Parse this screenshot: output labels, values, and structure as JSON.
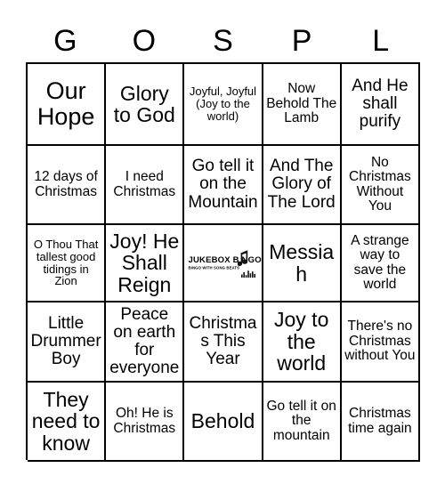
{
  "card": {
    "header_letters": [
      "G",
      "O",
      "S",
      "P",
      "L"
    ],
    "grid": {
      "rows": 5,
      "columns": 5,
      "cells": [
        [
          {
            "text": "Our Hope",
            "size": "xl"
          },
          {
            "text": "Glory to God",
            "size": "lg"
          },
          {
            "text": "Joyful, Joyful (Joy to the world)",
            "size": "xs"
          },
          {
            "text": "Now Behold The Lamb",
            "size": "sm"
          },
          {
            "text": "And He shall purify",
            "size": "md"
          }
        ],
        [
          {
            "text": "12 days of Christmas",
            "size": "sm"
          },
          {
            "text": "I need Christmas",
            "size": "sm"
          },
          {
            "text": "Go tell it on the Mountain",
            "size": "md"
          },
          {
            "text": "And The Glory of The Lord",
            "size": "md"
          },
          {
            "text": "No Christmas Without You",
            "size": "sm"
          }
        ],
        [
          {
            "text": "O Thou That tallest good tidings in Zion",
            "size": "xs"
          },
          {
            "text": "Joy! He Shall Reign",
            "size": "lg"
          },
          {
            "text": "",
            "size": "md",
            "free_space": true
          },
          {
            "text": "Messiah",
            "size": "lg"
          },
          {
            "text": "A strange way to save the world",
            "size": "sm"
          }
        ],
        [
          {
            "text": "Little Drummer Boy",
            "size": "md"
          },
          {
            "text": "Peace on earth for everyone",
            "size": "md"
          },
          {
            "text": "Christmas This Year",
            "size": "md"
          },
          {
            "text": "Joy to the world",
            "size": "lg"
          },
          {
            "text": "There's no Christmas without You",
            "size": "sm"
          }
        ],
        [
          {
            "text": "They need to know",
            "size": "lg"
          },
          {
            "text": "Oh! He is Christmas",
            "size": "sm"
          },
          {
            "text": "Behold",
            "size": "lg"
          },
          {
            "text": "Go tell it on the mountain",
            "size": "sm"
          },
          {
            "text": "Christmas time again",
            "size": "sm"
          }
        ]
      ]
    },
    "free_space_logo": {
      "wordmark": "JUKEBOX B NGO",
      "wordmark_prefix": "JUKEBOX B",
      "wordmark_suffix": "NGO",
      "tagline": "BINGO WITH SONG BEATS",
      "note_icon": "music-note-icon",
      "equalizer_icon": "equalizer-icon"
    },
    "colors": {
      "background": "#ffffff",
      "text": "#000000",
      "grid_line": "#000000"
    }
  }
}
